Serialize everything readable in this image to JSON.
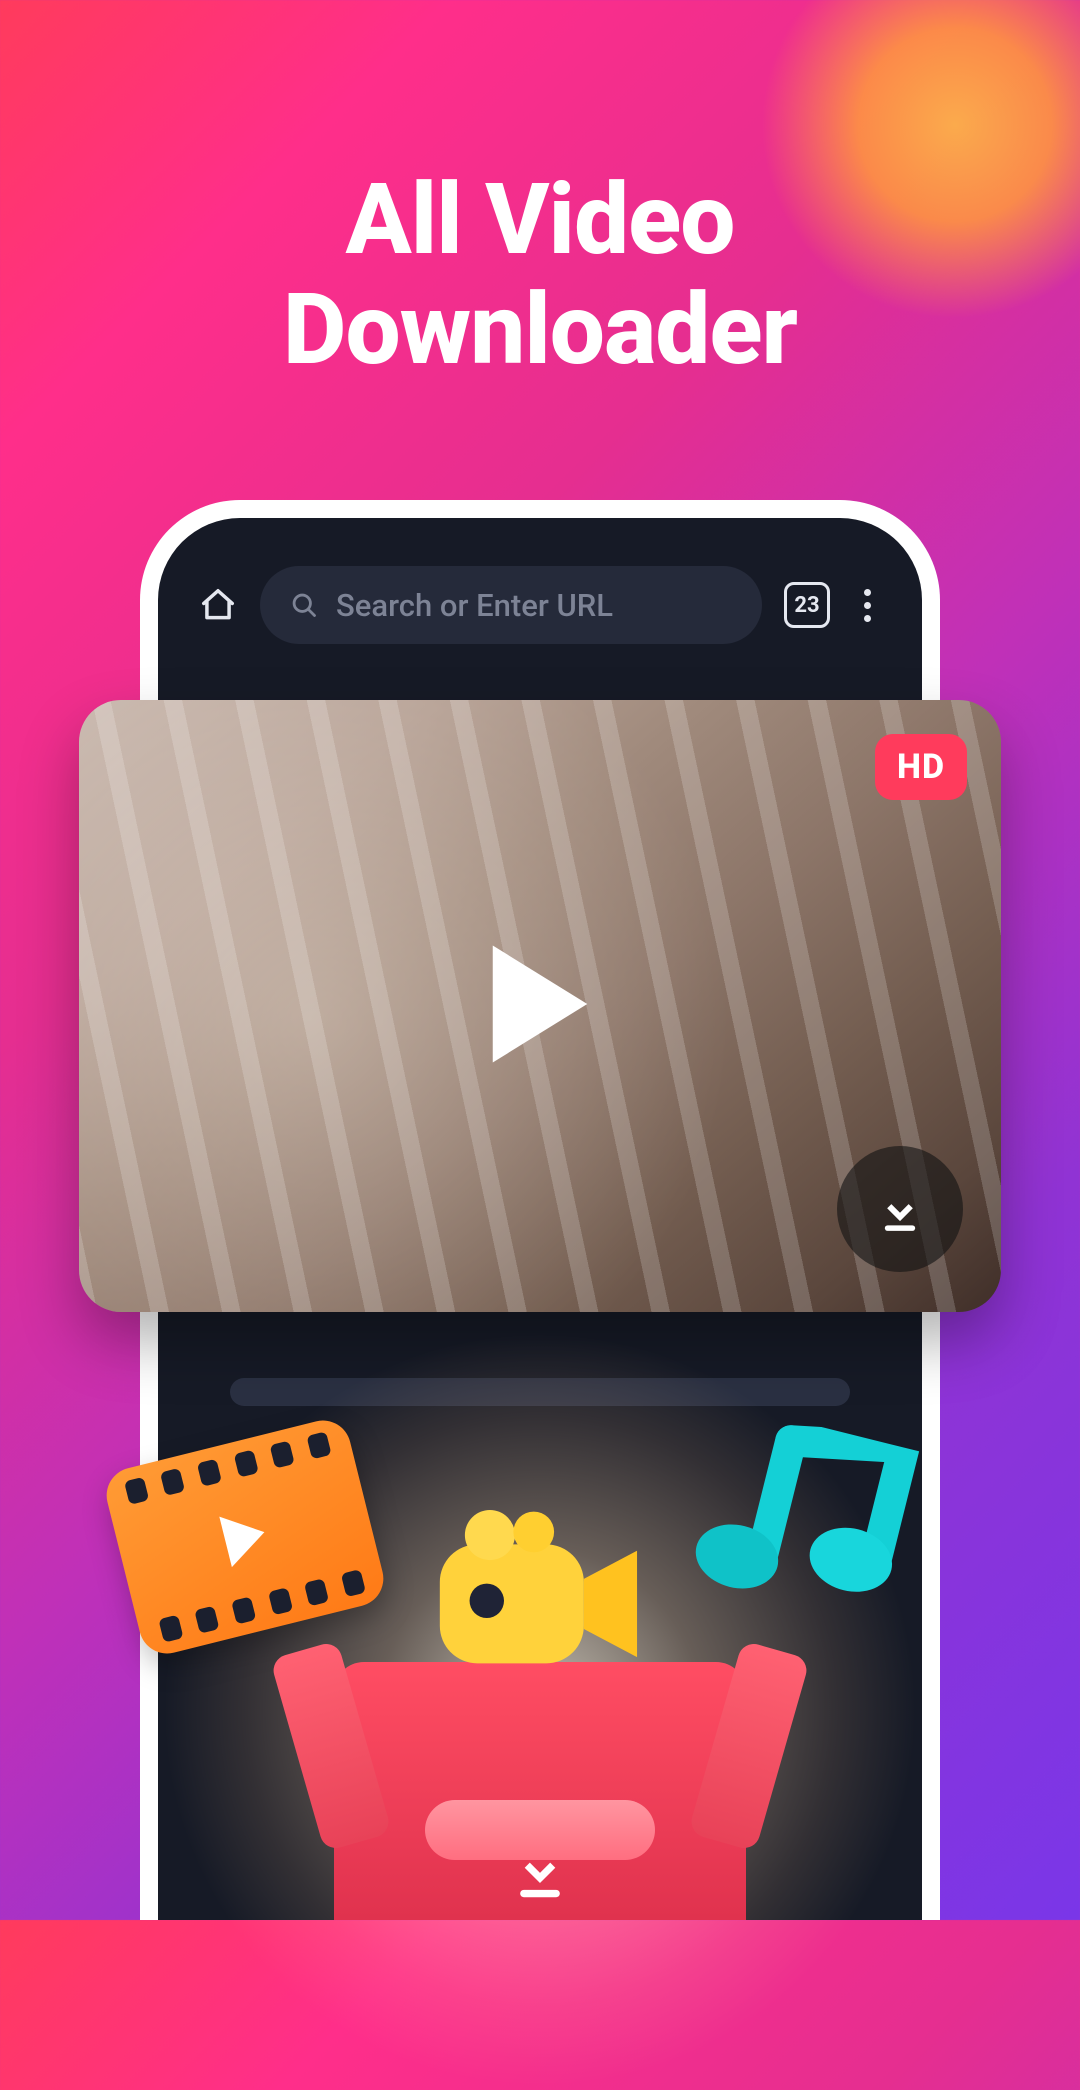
{
  "title_line1": "All Video",
  "title_line2": "Downloader",
  "browser": {
    "placeholder": "Search or Enter URL",
    "tab_count": "23"
  },
  "video": {
    "hd_badge": "HD",
    "colors": {
      "badge_bg": "#ff3b5c",
      "badge_text": "#ffffff"
    }
  },
  "icons": {
    "home": "home-icon",
    "search": "search-icon",
    "tabs": "tabs-icon",
    "kebab": "kebab-icon",
    "play": "play-icon",
    "download": "download-icon",
    "film": "film-strip-icon",
    "music": "music-note-icon",
    "camera": "camera-icon",
    "box_download": "box-download-icon"
  }
}
